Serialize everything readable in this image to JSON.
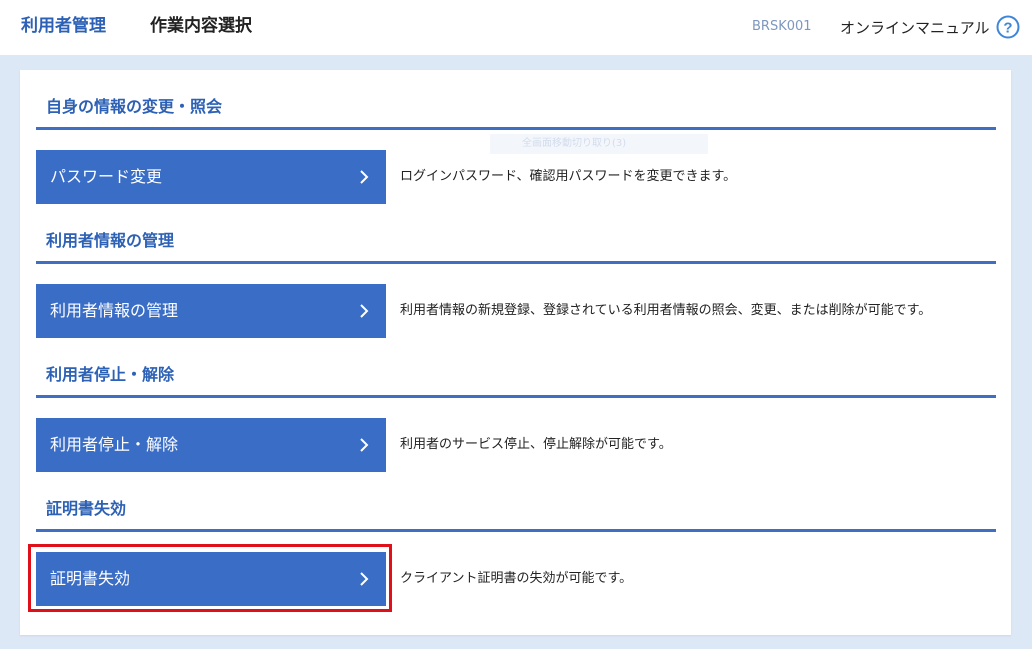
{
  "header": {
    "app_title": "利用者管理",
    "screen_title": "作業内容選択",
    "screen_id": "BRSK001",
    "manual_label": "オンラインマニュアル",
    "help_symbol": "?"
  },
  "faded_overlay_text": "全画面移動切り取り(3)",
  "sections": [
    {
      "heading": "自身の情報の変更・照会",
      "button_label": "パスワード変更",
      "description": "ログインパスワード、確認用パスワードを変更できます。"
    },
    {
      "heading": "利用者情報の管理",
      "button_label": "利用者情報の管理",
      "description": "利用者情報の新規登録、登録されている利用者情報の照会、変更、または削除が可能です。"
    },
    {
      "heading": "利用者停止・解除",
      "button_label": "利用者停止・解除",
      "description": "利用者のサービス停止、停止解除が可能です。"
    },
    {
      "heading": "証明書失効",
      "button_label": "証明書失効",
      "description": "クライアント証明書の失効が可能です。"
    }
  ],
  "icons": {
    "button_chevron": "chevron-right-icon",
    "help": "help-icon"
  },
  "colors": {
    "page_background": "#dde8f7",
    "brand_blue": "#2d61b5",
    "button_blue": "#3a6dc6",
    "highlight_red": "#e0101a"
  }
}
